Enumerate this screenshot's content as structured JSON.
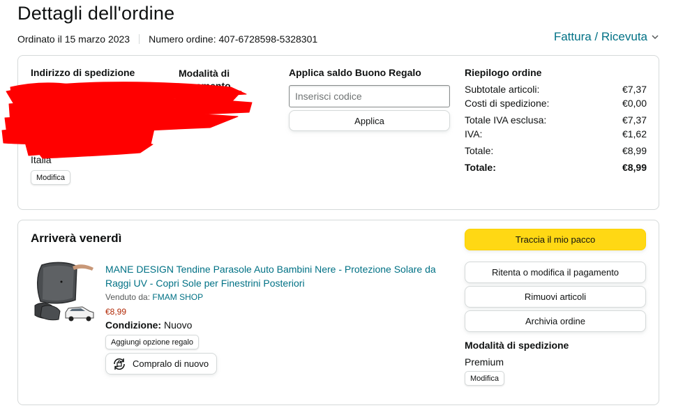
{
  "page": {
    "title": "Dettagli dell'ordine",
    "ordered_on": "Ordinato il 15 marzo 2023",
    "order_number": "Numero ordine: 407-6728598-5328301",
    "invoice_link": "Fattura / Ricevuta"
  },
  "shipping_address": {
    "heading": "Indirizzo di spedizione",
    "country": "Italia",
    "edit_label": "Modifica"
  },
  "payment": {
    "heading_line1": "Modalità di",
    "heading_line2": "pagamento"
  },
  "gift_card": {
    "heading": "Applica saldo Buono Regalo",
    "placeholder": "Inserisci codice",
    "apply_label": "Applica"
  },
  "summary": {
    "heading": "Riepilogo ordine",
    "rows": [
      {
        "label": "Subtotale articoli:",
        "value": "€7,37"
      },
      {
        "label": "Costi di spedizione:",
        "value": "€0,00"
      },
      {
        "label": "Totale IVA esclusa:",
        "value": "€7,37"
      },
      {
        "label": "IVA:",
        "value": "€1,62"
      },
      {
        "label": "Totale:",
        "value": "€8,99"
      },
      {
        "label": "Totale:",
        "value": "€8,99"
      }
    ]
  },
  "shipment": {
    "arrival": "Arriverà venerdì",
    "product_title": "MANE DESIGN Tendine Parasole Auto Bambini Nere - Protezione Solare da Raggi UV - Copri Sole per Finestrini Posteriori",
    "sold_by_label": "Venduto da:",
    "seller": "FMAM SHOP",
    "price": "€8,99",
    "condition_label": "Condizione:",
    "condition_value": "Nuovo",
    "gift_option_label": "Aggiungi opzione regalo",
    "rebuy_label": "Compralo di nuovo"
  },
  "actions": {
    "track": "Traccia il mio pacco",
    "retry_payment": "Ritenta o modifica il pagamento",
    "remove_items": "Rimuovi articoli",
    "archive": "Archivia ordine"
  },
  "delivery_method": {
    "heading": "Modalità di spedizione",
    "value": "Premium",
    "edit_label": "Modifica"
  },
  "icons": {
    "invoice_chevron": "chevron-down-icon",
    "rebuy": "rebuy-icon"
  },
  "colors": {
    "link": "#007185",
    "price": "#b12704",
    "primary_button": "#ffd814",
    "redaction": "#ff0000"
  }
}
